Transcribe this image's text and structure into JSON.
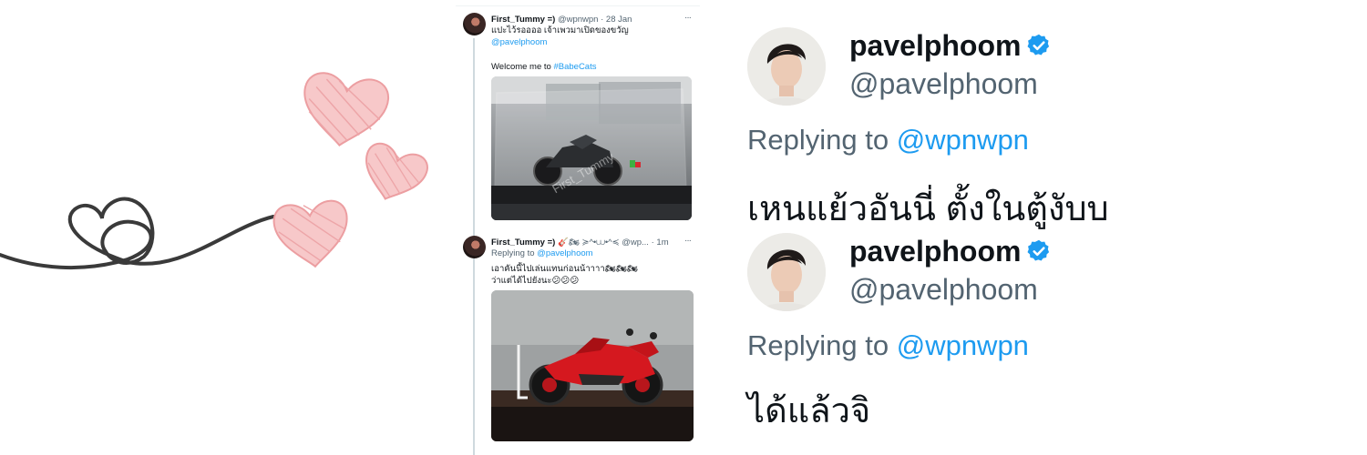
{
  "feed": {
    "tweet1": {
      "name": "First_Tummy =)",
      "handle": "@wpnwpn",
      "dot": "·",
      "time": "28 Jan",
      "more": "···",
      "line1": "แปะไว้รออออ เจ้าเพวมาเปิดของขวัญ",
      "mention": "@pavelphoom",
      "line3_prefix": "Welcome me to ",
      "hashtag": "#BabeCats",
      "watermark": "First_Tummy"
    },
    "tweet2": {
      "name": "First_Tummy =)",
      "name_suffix": "🎸🏍 ≽^•⩊•^≼",
      "handle": "@wp...",
      "dot": "·",
      "time": "1m",
      "more": "···",
      "replying_prefix": "Replying to ",
      "replying_to": "@pavelphoom",
      "line1": "เอาคันนี้ไปเล่นแทนก่อนน้าาาา🏍🏍🏍",
      "line2": "ว่าแต่ได้ไปยังนะ😕😕😕"
    }
  },
  "replies": [
    {
      "username": "pavelphoom",
      "handle": "@pavelphoom",
      "replying_prefix": "Replying to ",
      "replying_to": "@wpnwpn",
      "text": "เหนแย้วอันนี่ ตั้งในตู้งับบ"
    },
    {
      "username": "pavelphoom",
      "handle": "@pavelphoom",
      "replying_prefix": "Replying to ",
      "replying_to": "@wpnwpn",
      "text": "ได้แล้วจิ"
    }
  ],
  "colors": {
    "link": "#1d9bf0",
    "muted": "#536471",
    "heart_pink": "#f4b6b8",
    "squiggle": "#3a3a3a",
    "verified": "#1d9bf0"
  },
  "icons": [
    "heart-outline-icon",
    "pink-heart-icon",
    "verified-badge-icon",
    "more-icon"
  ]
}
